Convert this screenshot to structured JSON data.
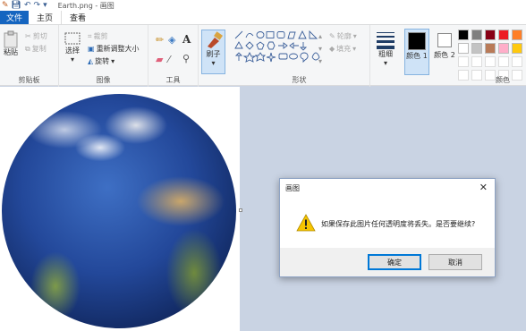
{
  "window": {
    "title": "Earth.png - 画图"
  },
  "tabs": {
    "file": "文件",
    "home": "主页",
    "view": "查看"
  },
  "clipboard": {
    "paste": "粘贴",
    "cut": "剪切",
    "copy": "复制",
    "label": "剪贴板"
  },
  "image": {
    "select": "选择",
    "crop": "裁剪",
    "resize": "重新调整大小",
    "rotate": "旋转",
    "label": "图像"
  },
  "tools": {
    "label": "工具"
  },
  "brushes": {
    "label": "刷子"
  },
  "shapes": {
    "outline": "轮廓",
    "fill": "填充",
    "label": "形状"
  },
  "size": {
    "label": "粗细"
  },
  "colors": {
    "color1_label": "颜色 1",
    "color2_label": "颜色 2",
    "group_label": "颜色",
    "color1": "#000000",
    "color2": "#ffffff",
    "palette": [
      "#000000",
      "#7f7f7f",
      "#880015",
      "#ed1c24",
      "#ff7f27",
      "#ffffff",
      "#c3c3c3",
      "#b97a57",
      "#ffaec9",
      "#ffc90e"
    ]
  },
  "dialog": {
    "title": "画图",
    "message": "如果保存此图片任何透明度将丢失。是否要继续?",
    "ok": "确定",
    "cancel": "取消",
    "icon": "warning-icon"
  }
}
